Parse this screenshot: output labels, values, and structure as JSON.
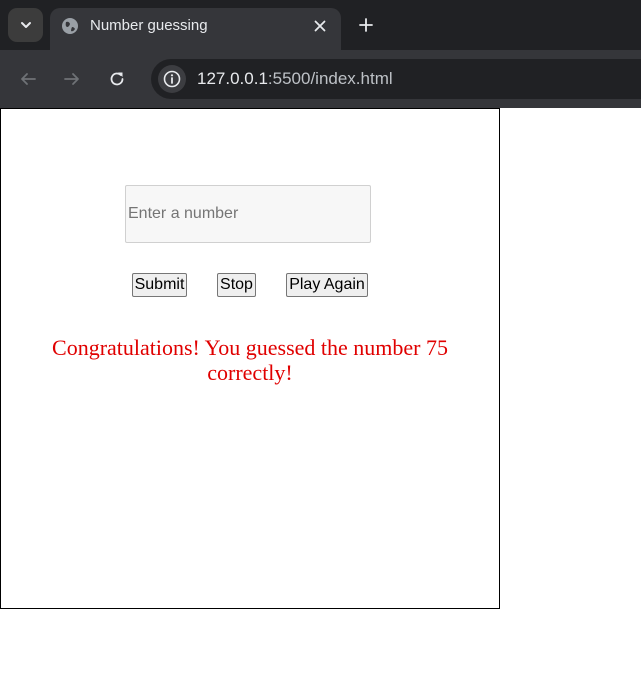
{
  "browser": {
    "tab": {
      "title": "Number guessing",
      "favicon": "globe-icon"
    },
    "address_bar": {
      "host": "127.0.0.1",
      "rest": ":5500/index.html"
    },
    "icons": {
      "tab_search": "chevron-down-icon",
      "close": "close-icon",
      "new_tab": "plus-icon",
      "back": "back-arrow-icon",
      "forward": "forward-arrow-icon",
      "reload": "reload-icon",
      "site_info": "info-icon"
    },
    "colors": {
      "tabstrip": "#202124",
      "toolbar": "#35363a",
      "text": "#e8eaed"
    }
  },
  "game": {
    "input": {
      "placeholder": "Enter a number",
      "value": ""
    },
    "buttons": {
      "submit": "Submit",
      "stop": "Stop",
      "play_again": "Play Again"
    },
    "message": "Congratulations! You guessed the number 75 correctly!",
    "message_color": "#e00000"
  }
}
